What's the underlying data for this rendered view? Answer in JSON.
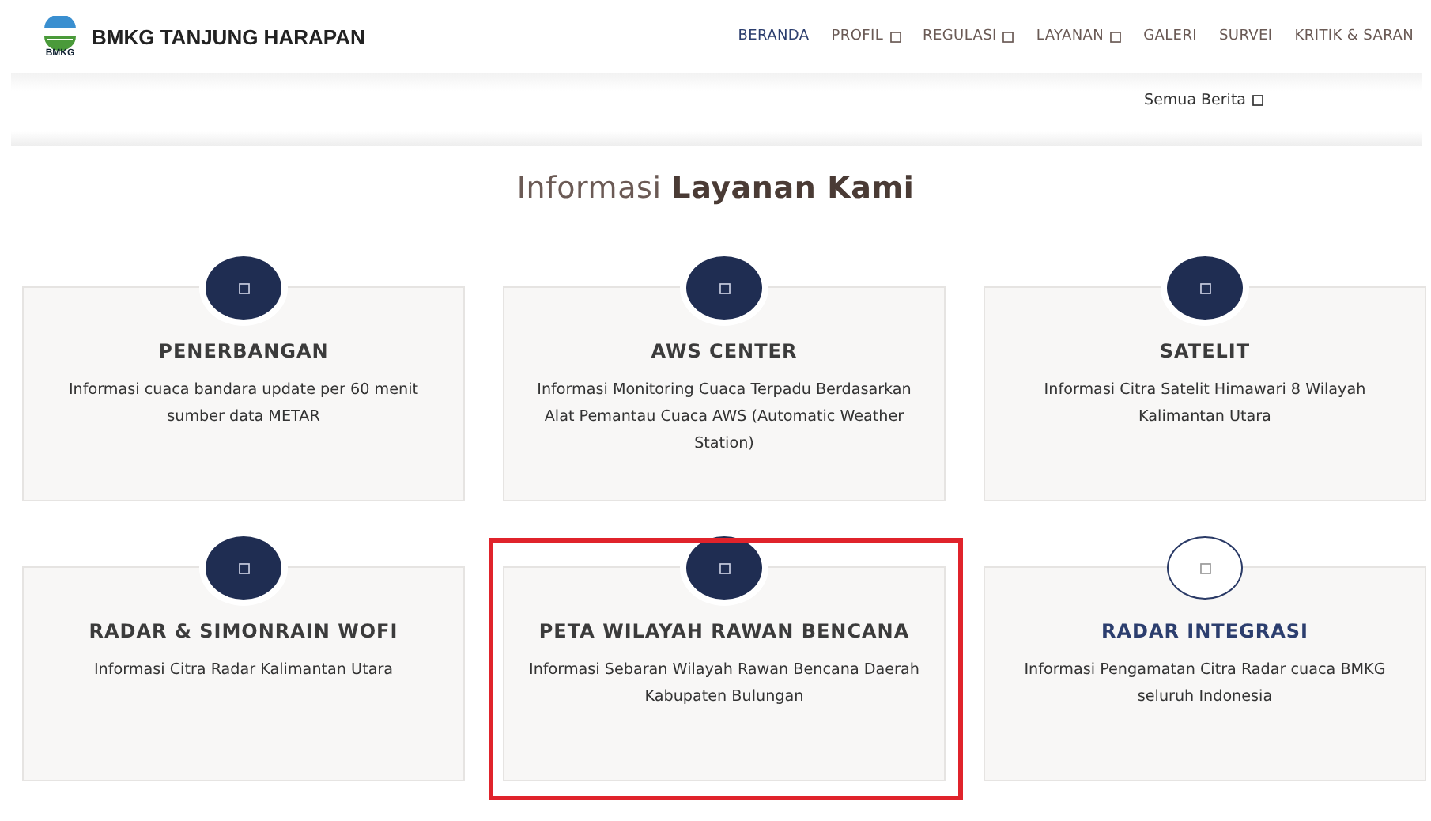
{
  "header": {
    "brand": "BMKG TANJUNG HARAPAN",
    "logo_text": "BMKG"
  },
  "nav": [
    {
      "label": "BERANDA",
      "selected": true,
      "dropdown": false
    },
    {
      "label": "PROFIL",
      "selected": false,
      "dropdown": true
    },
    {
      "label": "REGULASI",
      "selected": false,
      "dropdown": true
    },
    {
      "label": "LAYANAN",
      "selected": false,
      "dropdown": true
    },
    {
      "label": "GALERI",
      "selected": false,
      "dropdown": false
    },
    {
      "label": "SURVEI",
      "selected": false,
      "dropdown": false
    },
    {
      "label": "KRITIK & SARAN",
      "selected": false,
      "dropdown": false
    }
  ],
  "news_link": "Semua Berita",
  "section_title": "Informasi **Layanan Kami**",
  "cards": [
    {
      "title": "PENERBANGAN",
      "description": "Informasi cuaca bandara update per 60 menit sumber data METAR",
      "active": false,
      "highlighted": false
    },
    {
      "title": "AWS CENTER",
      "description": "Informasi Monitoring Cuaca Terpadu Berdasarkan Alat Pemantau Cuaca AWS (Automatic Weather Station)",
      "active": false,
      "highlighted": false
    },
    {
      "title": "SATELIT",
      "description": "Informasi Citra Satelit Himawari 8 Wilayah Kalimantan Utara",
      "active": false,
      "highlighted": false
    },
    {
      "title": "RADAR & SIMONRAIN WOFI",
      "description": "Informasi Citra Radar Kalimantan Utara",
      "active": false,
      "highlighted": false
    },
    {
      "title": "PETA WILAYAH RAWAN BENCANA",
      "description": "Informasi Sebaran Wilayah Rawan Bencana Daerah Kabupaten Bulungan",
      "active": false,
      "highlighted": true
    },
    {
      "title": "RADAR INTEGRASI",
      "description": "Informasi Pengamatan Citra Radar cuaca BMKG seluruh Indonesia",
      "active": true,
      "highlighted": false
    }
  ]
}
